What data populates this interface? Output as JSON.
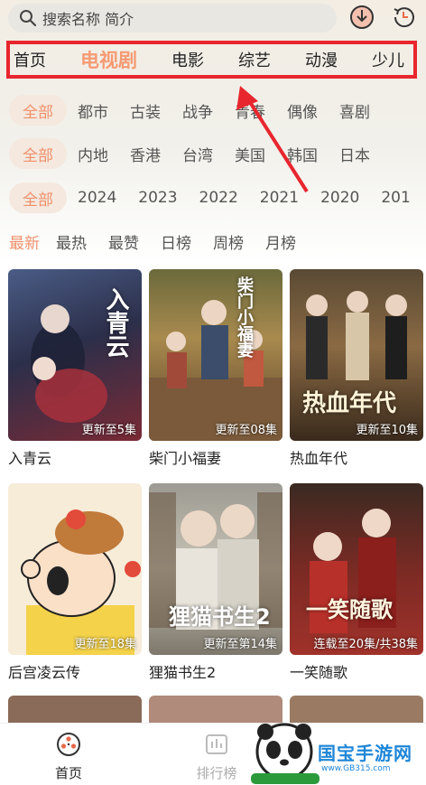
{
  "search": {
    "placeholder": "搜索名称 简介"
  },
  "top_icons": [
    "download-icon",
    "history-icon"
  ],
  "nav": {
    "tabs": [
      {
        "label": "首页"
      },
      {
        "label": "电视剧",
        "active": true
      },
      {
        "label": "电影"
      },
      {
        "label": "综艺"
      },
      {
        "label": "动漫"
      },
      {
        "label": "少儿"
      }
    ]
  },
  "filters": {
    "genre": {
      "selected": "全部",
      "options": [
        "都市",
        "古装",
        "战争",
        "青春",
        "偶像",
        "喜剧"
      ]
    },
    "region": {
      "selected": "全部",
      "options": [
        "内地",
        "香港",
        "台湾",
        "美国",
        "韩国",
        "日本"
      ]
    },
    "year": {
      "selected": "全部",
      "options": [
        "2024",
        "2023",
        "2022",
        "2021",
        "2020",
        "201"
      ]
    },
    "sort": {
      "selected": "最新",
      "options": [
        "最热",
        "最赞",
        "日榜",
        "周榜",
        "月榜"
      ]
    }
  },
  "shows": [
    {
      "name": "入青云",
      "badge": "更新至5集",
      "poster_text": "入青云"
    },
    {
      "name": "柴门小福妻",
      "badge": "更新至08集",
      "poster_text": "柴门小福妻"
    },
    {
      "name": "热血年代",
      "badge": "更新至10集",
      "poster_text": "热血年代"
    },
    {
      "name": "后宫凌云传",
      "badge": "更新至18集",
      "poster_text": ""
    },
    {
      "name": "狸猫书生2",
      "badge": "更新至第14集",
      "poster_text": "狸猫书生2"
    },
    {
      "name": "一笑随歌",
      "badge": "连载至20集/共38集",
      "poster_text": "一笑随歌"
    }
  ],
  "bottom_nav": [
    {
      "label": "首页",
      "icon": "film-reel-icon",
      "active": true
    },
    {
      "label": "排行榜",
      "icon": "chart-icon"
    }
  ],
  "watermark": {
    "text": "国宝手游网",
    "url": "www.GB315.com"
  },
  "colors": {
    "accent": "#f0906a",
    "highlight_box": "#e8262e",
    "watermark_blue": "#1e86d8"
  }
}
